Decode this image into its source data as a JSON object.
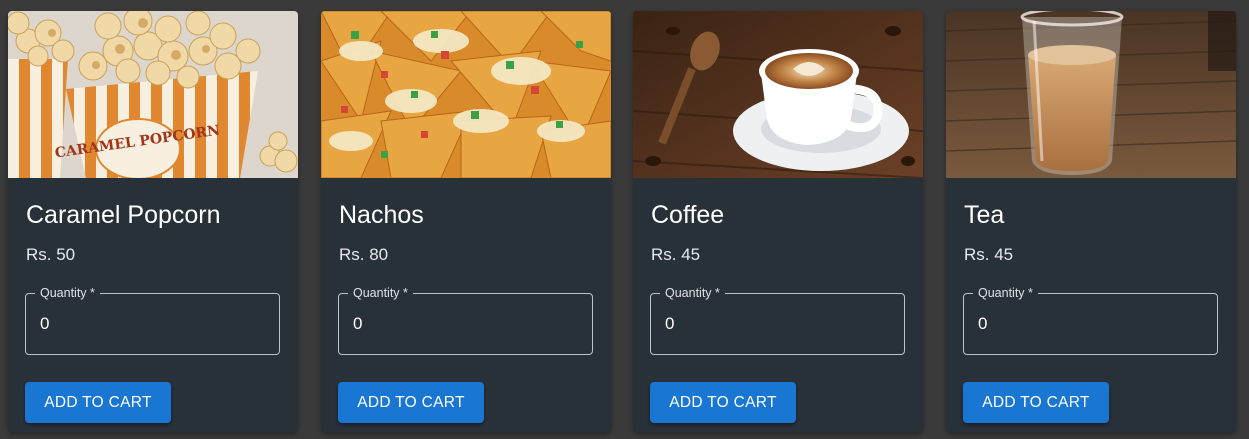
{
  "products": [
    {
      "name": "Caramel Popcorn",
      "price": "Rs. 50",
      "quantity_label": "Quantity *",
      "quantity_value": "0",
      "button_label": "ADD TO CART",
      "image_icon": "popcorn-image",
      "box_text": "CARAMEL POPCORN"
    },
    {
      "name": "Nachos",
      "price": "Rs. 80",
      "quantity_label": "Quantity *",
      "quantity_value": "0",
      "button_label": "ADD TO CART",
      "image_icon": "nachos-image"
    },
    {
      "name": "Coffee",
      "price": "Rs. 45",
      "quantity_label": "Quantity *",
      "quantity_value": "0",
      "button_label": "ADD TO CART",
      "image_icon": "coffee-image"
    },
    {
      "name": "Tea",
      "price": "Rs. 45",
      "quantity_label": "Quantity *",
      "quantity_value": "0",
      "button_label": "ADD TO CART",
      "image_icon": "tea-image"
    }
  ],
  "colors": {
    "page_background": "#3a3a3a",
    "card_background": "#283038",
    "button_primary": "#1976d2",
    "text_primary": "#ffffff"
  }
}
